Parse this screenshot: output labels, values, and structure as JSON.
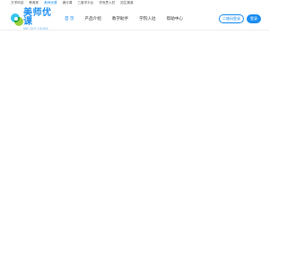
{
  "topbar": {
    "links": [
      {
        "label": "万学科技"
      },
      {
        "label": "教育家"
      },
      {
        "label": "美师优课"
      },
      {
        "label": "满分课"
      },
      {
        "label": "三度学平台"
      },
      {
        "label": "学而思入驻"
      },
      {
        "label": "招生渠道"
      }
    ],
    "active_index": 2
  },
  "logo": {
    "name_cn": "美师优课",
    "name_en": "MEI SHI YOUKE"
  },
  "nav": {
    "items": [
      {
        "label": "首 页"
      },
      {
        "label": "产品介绍"
      },
      {
        "label": "教学助手"
      },
      {
        "label": "学院入驻"
      },
      {
        "label": "帮助中心"
      }
    ],
    "active_index": 0
  },
  "actions": {
    "outline_label": "二维码登录",
    "solid_label": "登录"
  },
  "colors": {
    "accent": "#1c8df2",
    "logo_green": "#9ad13b",
    "logo_cyan": "#36c5ef"
  }
}
